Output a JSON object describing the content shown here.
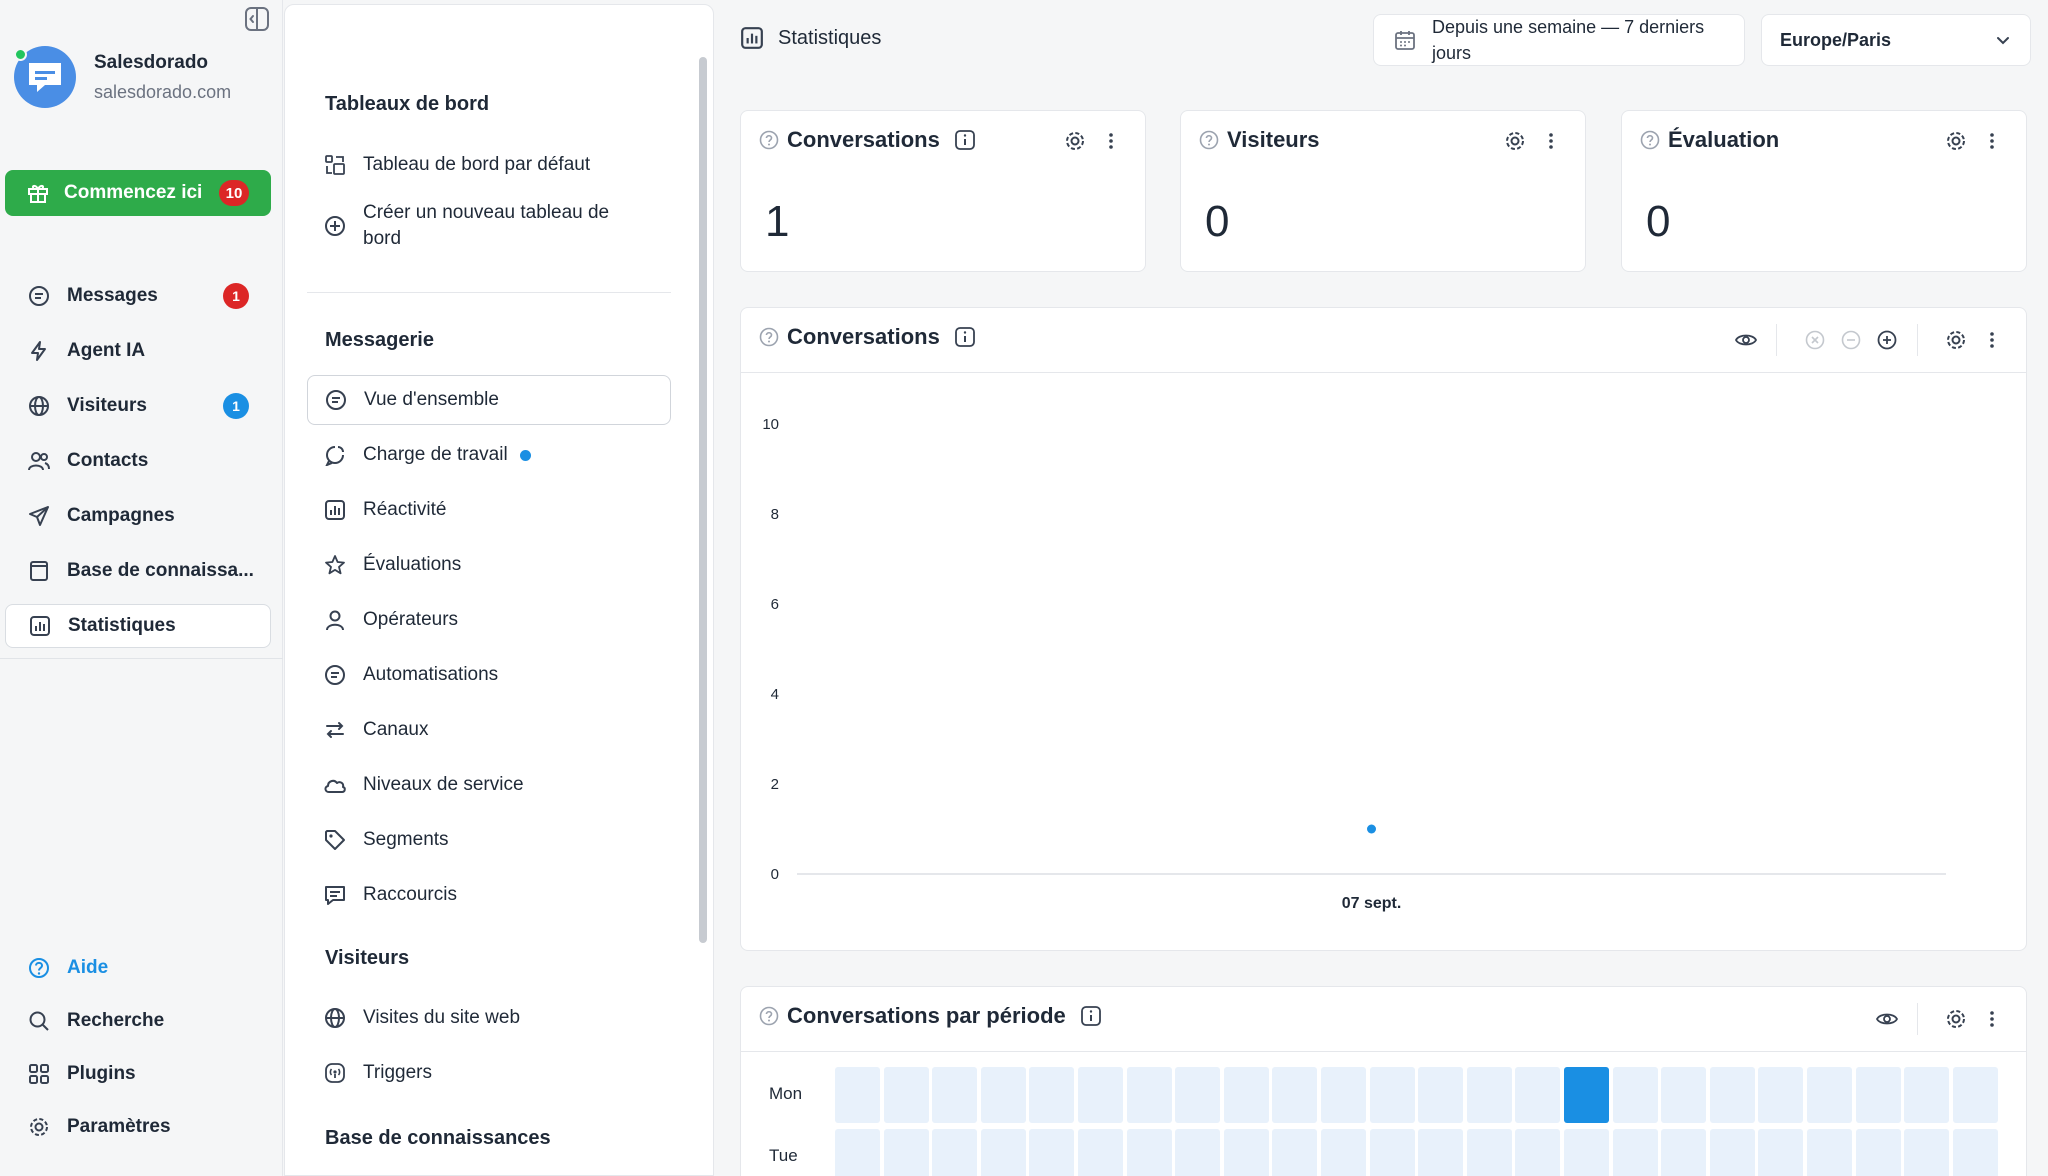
{
  "org": {
    "name": "Salesdorado",
    "domain": "salesdorado.com"
  },
  "start": {
    "label": "Commencez ici",
    "badge": "10"
  },
  "nav": [
    {
      "label": "Messages",
      "badge": "1",
      "badge_color": "#dc2626"
    },
    {
      "label": "Agent IA"
    },
    {
      "label": "Visiteurs",
      "badge": "1",
      "badge_color": "#1a8fe3"
    },
    {
      "label": "Contacts"
    },
    {
      "label": "Campagnes"
    },
    {
      "label": "Base de connaissa..."
    },
    {
      "label": "Statistiques",
      "active": true
    }
  ],
  "bottom_nav": [
    {
      "label": "Aide"
    },
    {
      "label": "Recherche"
    },
    {
      "label": "Plugins"
    },
    {
      "label": "Paramètres"
    }
  ],
  "subpanel": {
    "sections": [
      {
        "title": "Tableaux de bord",
        "items": [
          {
            "label": "Tableau de bord par défaut"
          },
          {
            "label": "Créer un nouveau tableau de bord"
          }
        ]
      },
      {
        "title": "Messagerie",
        "items": [
          {
            "label": "Vue d'ensemble",
            "active": true
          },
          {
            "label": "Charge de travail",
            "dot": true
          },
          {
            "label": "Réactivité"
          },
          {
            "label": "Évaluations"
          },
          {
            "label": "Opérateurs"
          },
          {
            "label": "Automatisations"
          },
          {
            "label": "Canaux"
          },
          {
            "label": "Niveaux de service"
          },
          {
            "label": "Segments"
          },
          {
            "label": "Raccourcis"
          }
        ]
      },
      {
        "title": "Visiteurs",
        "items": [
          {
            "label": "Visites du site web"
          },
          {
            "label": "Triggers"
          }
        ]
      },
      {
        "title": "Base de connaissances",
        "items": []
      }
    ]
  },
  "header": {
    "title": "Statistiques",
    "date_range": "Depuis une semaine — 7 derniers jours",
    "timezone": "Europe/Paris"
  },
  "kpis": [
    {
      "title": "Conversations",
      "value": "1"
    },
    {
      "title": "Visiteurs",
      "value": "0"
    },
    {
      "title": "Évaluation",
      "value": "0"
    }
  ],
  "chart_card": {
    "title": "Conversations"
  },
  "chart_data": {
    "type": "scatter",
    "x": [
      "07 sept."
    ],
    "y": [
      1
    ],
    "ylim": [
      0,
      10
    ],
    "yticks": [
      0,
      2,
      4,
      6,
      8,
      10
    ],
    "color": "#1a8fe3"
  },
  "heatmap_card": {
    "title": "Conversations par période",
    "rows": [
      "Mon",
      "Tue"
    ],
    "columns": 24,
    "highlight": {
      "row": 0,
      "col": 15
    },
    "colors": {
      "base": "#e8f1fb",
      "high": "#1a8fe3"
    }
  },
  "colors": {
    "accent": "#1a8fe3",
    "success": "#2eab4a",
    "danger": "#dc2626"
  }
}
